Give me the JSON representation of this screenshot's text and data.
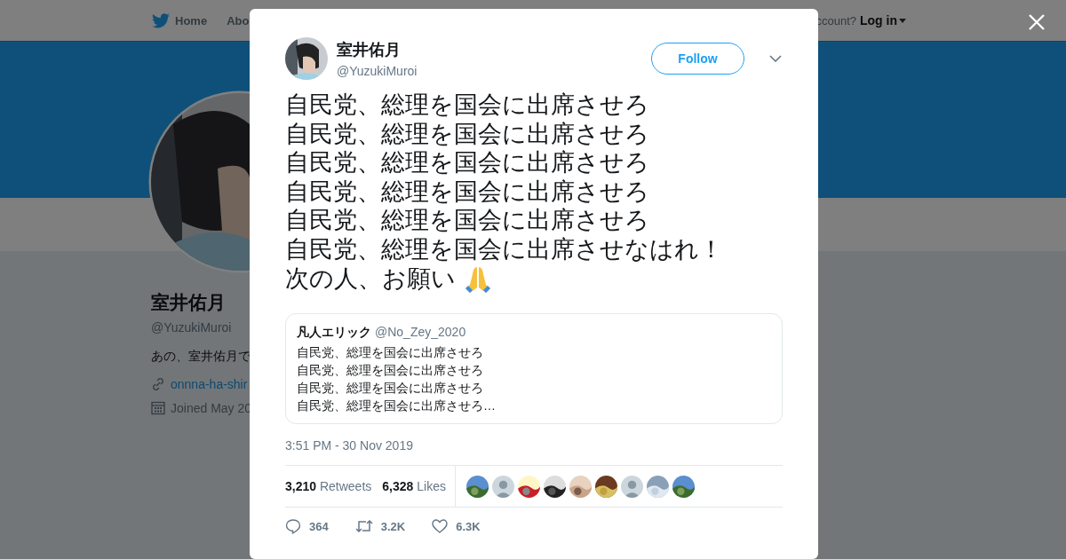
{
  "nav": {
    "items": [
      {
        "kind": "home",
        "label": "Home"
      },
      {
        "kind": "plain",
        "label": "Abo"
      }
    ],
    "account_prompt": "ccount?",
    "login": "Log in"
  },
  "profile": {
    "name": "室井佑月",
    "handle": "@YuzukiMuroi",
    "bio": "あの、室井佑月で",
    "link": "onnna-ha-shir",
    "joined": "Joined May 20"
  },
  "tweet": {
    "author": {
      "name": "室井佑月",
      "handle": "@YuzukiMuroi"
    },
    "follow_button": "Follow",
    "lines": [
      "自民党、総理を国会に出席させろ",
      "自民党、総理を国会に出席させろ",
      "自民党、総理を国会に出席させろ",
      "自民党、総理を国会に出席させろ",
      "自民党、総理を国会に出席させろ",
      "自民党、総理を国会に出席させなはれ！",
      "次の人、お願い"
    ],
    "quote": {
      "name": "凡人エリック",
      "handle": "@No_Zey_2020",
      "lines": [
        "自民党、総理を国会に出席させろ",
        "自民党、総理を国会に出席させろ",
        "自民党、総理を国会に出席させろ",
        "自民党、総理を国会に出席させろ…"
      ]
    },
    "timestamp": "3:51 PM - 30 Nov 2019",
    "stats": [
      {
        "count": "3,210",
        "label": "Retweets"
      },
      {
        "count": "6,328",
        "label": "Likes"
      }
    ],
    "likers": [
      {
        "kind": "picture"
      },
      {
        "kind": "default"
      },
      {
        "kind": "picture"
      },
      {
        "kind": "picture"
      },
      {
        "kind": "picture"
      },
      {
        "kind": "picture"
      },
      {
        "kind": "default"
      },
      {
        "kind": "picture"
      },
      {
        "kind": "picture"
      }
    ],
    "actions": [
      {
        "kind": "reply",
        "count": "364"
      },
      {
        "kind": "retweet",
        "count": "3.2K"
      },
      {
        "kind": "like",
        "count": "6.3K"
      }
    ]
  }
}
